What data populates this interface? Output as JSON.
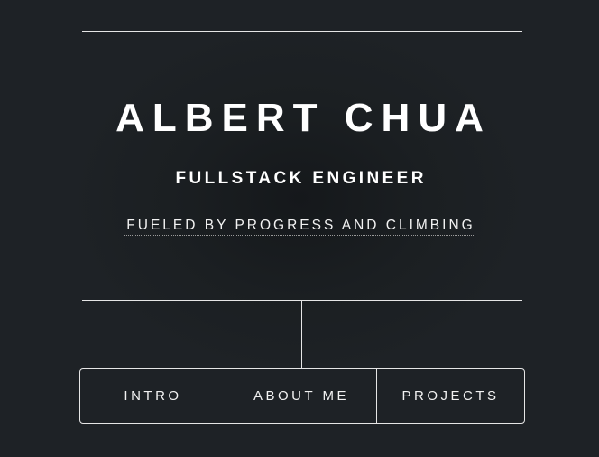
{
  "header": {
    "name": "ALBERT CHUA",
    "role": "FULLSTACK ENGINEER",
    "tagline": "FUELED BY PROGRESS AND CLIMBING"
  },
  "nav": {
    "items": [
      {
        "label": "INTRO"
      },
      {
        "label": "ABOUT ME"
      },
      {
        "label": "PROJECTS"
      }
    ]
  },
  "colors": {
    "background": "#1e2226",
    "text": "#ffffff",
    "lines": "#e6e6e6"
  }
}
